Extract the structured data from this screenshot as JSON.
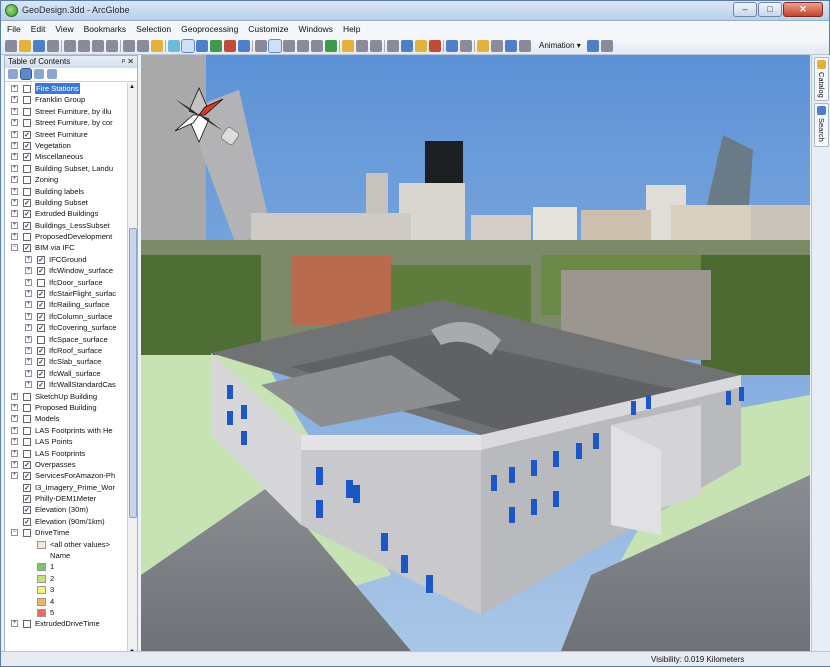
{
  "window": {
    "title": "GeoDesign.3dd - ArcGlobe"
  },
  "menu": [
    "File",
    "Edit",
    "View",
    "Bookmarks",
    "Selection",
    "Geoprocessing",
    "Customize",
    "Windows",
    "Help"
  ],
  "toolbar": {
    "animation_label": "Animation ▾"
  },
  "toc": {
    "title": "Table of Contents",
    "layers": [
      {
        "label": "Fire Stations",
        "indent": 0,
        "checked": false,
        "expander": "plus",
        "highlight": true
      },
      {
        "label": "Franklin Group",
        "indent": 0,
        "checked": false,
        "expander": "plus"
      },
      {
        "label": "Street Furniture, by illu",
        "indent": 0,
        "checked": false,
        "expander": "plus"
      },
      {
        "label": "Street Furniture, by cor",
        "indent": 0,
        "checked": false,
        "expander": "plus"
      },
      {
        "label": "Street Furniture",
        "indent": 0,
        "checked": true,
        "expander": "plus"
      },
      {
        "label": "Vegetation",
        "indent": 0,
        "checked": true,
        "expander": "plus"
      },
      {
        "label": "Miscellaneous",
        "indent": 0,
        "checked": true,
        "expander": "plus"
      },
      {
        "label": "Building Subset, Landu",
        "indent": 0,
        "checked": false,
        "expander": "plus"
      },
      {
        "label": "Zoning",
        "indent": 0,
        "checked": false,
        "expander": "plus"
      },
      {
        "label": "Building labels",
        "indent": 0,
        "checked": false,
        "expander": "plus"
      },
      {
        "label": "Building Subset",
        "indent": 0,
        "checked": true,
        "expander": "plus"
      },
      {
        "label": "Extruded Buildings",
        "indent": 0,
        "checked": true,
        "expander": "plus"
      },
      {
        "label": "Buildings_LessSubset",
        "indent": 0,
        "checked": true,
        "expander": "plus"
      },
      {
        "label": "ProposedDevelopment",
        "indent": 0,
        "checked": false,
        "expander": "plus"
      },
      {
        "label": "BIM via IFC",
        "indent": 0,
        "checked": true,
        "expander": "minus"
      },
      {
        "label": "IFCGround",
        "indent": 1,
        "checked": true,
        "expander": "plus"
      },
      {
        "label": "IfcWindow_surface",
        "indent": 1,
        "checked": true,
        "expander": "plus"
      },
      {
        "label": "IfcDoor_surface",
        "indent": 1,
        "checked": false,
        "expander": "plus"
      },
      {
        "label": "IfcStairFlight_surfac",
        "indent": 1,
        "checked": true,
        "expander": "plus"
      },
      {
        "label": "IfcRailing_surface",
        "indent": 1,
        "checked": true,
        "expander": "plus"
      },
      {
        "label": "IfcColumn_surface",
        "indent": 1,
        "checked": true,
        "expander": "plus"
      },
      {
        "label": "IfcCovering_surface",
        "indent": 1,
        "checked": true,
        "expander": "plus"
      },
      {
        "label": "IfcSpace_surface",
        "indent": 1,
        "checked": false,
        "expander": "plus"
      },
      {
        "label": "IfcRoof_surface",
        "indent": 1,
        "checked": true,
        "expander": "plus"
      },
      {
        "label": "IfcSlab_surface",
        "indent": 1,
        "checked": true,
        "expander": "plus"
      },
      {
        "label": "IfcWall_surface",
        "indent": 1,
        "checked": true,
        "expander": "plus"
      },
      {
        "label": "IfcWallStandardCas",
        "indent": 1,
        "checked": true,
        "expander": "plus"
      },
      {
        "label": "SketchUp Building",
        "indent": 0,
        "checked": false,
        "expander": "plus"
      },
      {
        "label": "Proposed Building",
        "indent": 0,
        "checked": false,
        "expander": "plus"
      },
      {
        "label": "Models",
        "indent": 0,
        "checked": false,
        "expander": "plus"
      },
      {
        "label": "LAS Footprints with He",
        "indent": 0,
        "checked": false,
        "expander": "plus"
      },
      {
        "label": "LAS Points",
        "indent": 0,
        "checked": false,
        "expander": "plus"
      },
      {
        "label": "LAS Footprints",
        "indent": 0,
        "checked": false,
        "expander": "plus"
      },
      {
        "label": "Overpasses",
        "indent": 0,
        "checked": true,
        "expander": "plus"
      },
      {
        "label": "ServicesForAmazon-Ph",
        "indent": 0,
        "checked": true,
        "expander": "plus"
      },
      {
        "label": "I3_Imagery_Prime_Wor",
        "indent": 0,
        "checked": true,
        "expander": "none"
      },
      {
        "label": "Philly-DEM1Meter",
        "indent": 0,
        "checked": true,
        "expander": "none"
      },
      {
        "label": "Elevation (30m)",
        "indent": 0,
        "checked": true,
        "expander": "none"
      },
      {
        "label": "Elevation (90m/1km)",
        "indent": 0,
        "checked": true,
        "expander": "none"
      },
      {
        "label": "DriveTime",
        "indent": 0,
        "checked": false,
        "expander": "minus"
      }
    ],
    "legend": {
      "other_label": "<all other values>",
      "other_color": "#f7ead3",
      "field_label": "Name",
      "classes": [
        {
          "label": "1",
          "color": "#7fc66b"
        },
        {
          "label": "2",
          "color": "#c7e07d"
        },
        {
          "label": "3",
          "color": "#f7f07a"
        },
        {
          "label": "4",
          "color": "#f7b062"
        },
        {
          "label": "5",
          "color": "#ef6a5a"
        }
      ]
    },
    "last_layer": {
      "label": "ExtrudedDriveTime",
      "checked": false
    }
  },
  "side_tabs": {
    "catalog": "Catalog",
    "search": "Search"
  },
  "status": {
    "visibility": "Visibility:  0.019 Kilometers"
  }
}
